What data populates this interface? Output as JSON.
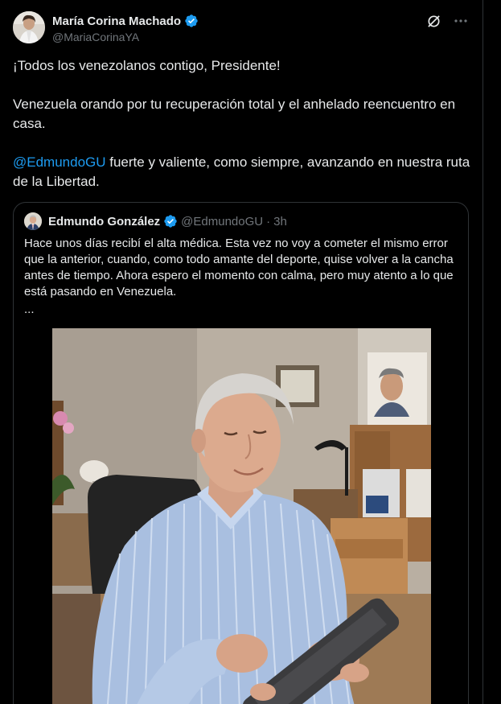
{
  "tweet": {
    "author_name": "María Corina Machado",
    "author_handle": "@MariaCorinaYA",
    "text_line1": "¡Todos los venezolanos contigo, Presidente!",
    "text_line2": "Venezuela orando por tu recuperación total y el anhelado reencuentro en casa.",
    "mention": "@EdmundoGU",
    "text_line3_rest": " fuerte y valiente, como siempre, avanzando en nuestra ruta de la Libertad."
  },
  "quote": {
    "author_name": "Edmundo González",
    "author_handle": "@EdmundoGU",
    "separator": "·",
    "time": "3h",
    "text": "Hace unos días recibí el alta médica. Esta vez no voy a cometer el mismo error que la anterior, cuando, como todo amante del deporte, quise volver a la cancha antes de tiempo. Ahora espero el momento con calma, pero muy atento a lo que está pasando en Venezuela.",
    "ellipsis": "..."
  },
  "icons": {
    "verified": "verified-badge-icon",
    "grok": "grok-icon",
    "more": "more-icon"
  },
  "colors": {
    "background": "#000000",
    "text": "#e7e9ea",
    "secondary": "#71767b",
    "accent": "#1d9bf0",
    "border": "#2f3336"
  }
}
